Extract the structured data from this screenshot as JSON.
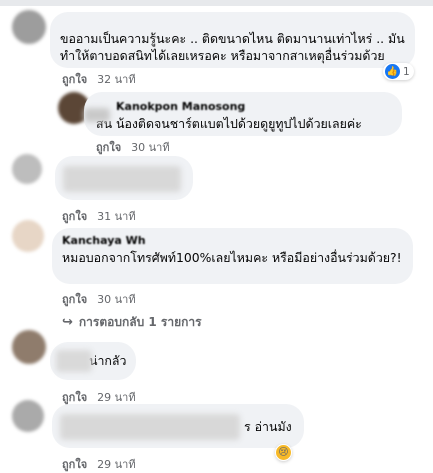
{
  "comments": [
    {
      "text": "ขออามเป็นความรู้นะคะ .. ติดขนาดไหน ติดมานานเท่าไหร่ .. มันทำให้ตาบอดสนิทได้เลยเหรอคะ หรือมาจากสาเหตุอื่นร่วมด้วย",
      "like": "ถูกใจ",
      "time": "32 นาที",
      "reaction_count": "1",
      "reaction_icon": "like-icon"
    },
    {
      "name": "Kanokpon Manosong",
      "text": "สน น้องติดจนชาร์ตแบตไปด้วยดูยูทูปไปด้วยเลยค่ะ",
      "like": "ถูกใจ",
      "time": "30 นาที"
    },
    {
      "text": "",
      "like": "ถูกใจ",
      "time": "31 นาที"
    },
    {
      "name": "Kanchaya Wh",
      "text": "หมอบอกจากโทรศัพท์100%เลยไหมคะ หรือมีอย่างอื่นร่วมด้วย?!",
      "like": "ถูกใจ",
      "time": "30 นาที",
      "replies": "การตอบกลับ 1 รายการ"
    },
    {
      "text": "น่ากลัว",
      "like": "ถูกใจ",
      "time": "29 นาที"
    },
    {
      "text": "ร อ่านมัง",
      "like": "ถูกใจ",
      "time": "29 นาที",
      "reaction_icon": "sad-icon"
    }
  ]
}
